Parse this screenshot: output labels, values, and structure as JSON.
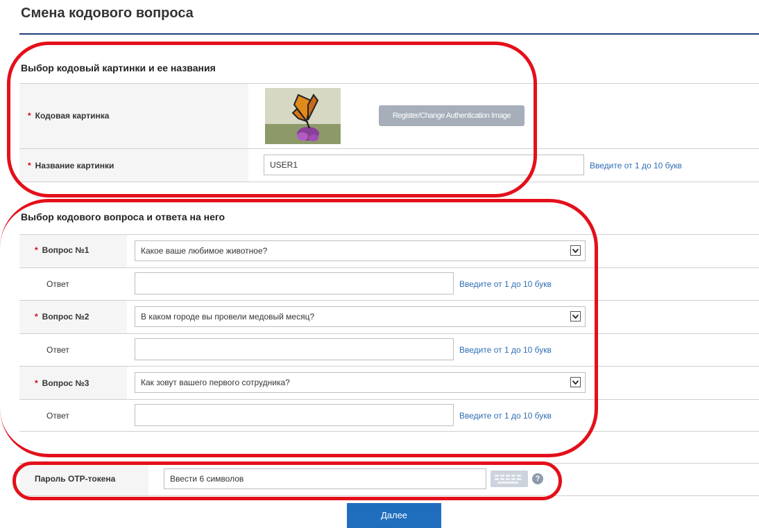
{
  "page": {
    "title": "Смена кодового вопроса"
  },
  "image_section": {
    "title": "Выбор кодовый картинки и ее названия",
    "image_label": "Кодовая картинка",
    "image_button": "Register/Change Authentication Image",
    "name_label": "Название картинки",
    "name_value": "USER1",
    "name_hint": "Введите от 1 до 10 букв"
  },
  "question_section": {
    "title": "Выбор кодового вопроса и ответа на него",
    "items": [
      {
        "q_label": "Вопрос №1",
        "q_value": "Какое ваше любимое животное?",
        "a_label": "Ответ",
        "a_value": "",
        "a_hint": "Введите от 1 до 10 букв"
      },
      {
        "q_label": "Вопрос №2",
        "q_value": "В каком городе вы провели медовый месяц?",
        "a_label": "Ответ",
        "a_value": "",
        "a_hint": "Введите от 1 до 10 букв"
      },
      {
        "q_label": "Вопрос №3",
        "q_value": "Как зовут вашего первого сотрудника?",
        "a_label": "Ответ",
        "a_value": "",
        "a_hint": "Введите от 1 до 10 букв"
      }
    ]
  },
  "otp": {
    "label": "Пароль OTP-токена",
    "placeholder": "Ввести 6 символов",
    "help_symbol": "?"
  },
  "actions": {
    "next": "Далее"
  },
  "icons": {
    "select_arrow": "chevron-down-icon",
    "keyboard": "keyboard-icon",
    "help": "help-icon"
  },
  "colors": {
    "accent": "#1f6ebd",
    "title_rule": "#1f3f7a",
    "hint": "#2f6db5",
    "required": "#d0021b",
    "annotation": "#e3101b"
  }
}
